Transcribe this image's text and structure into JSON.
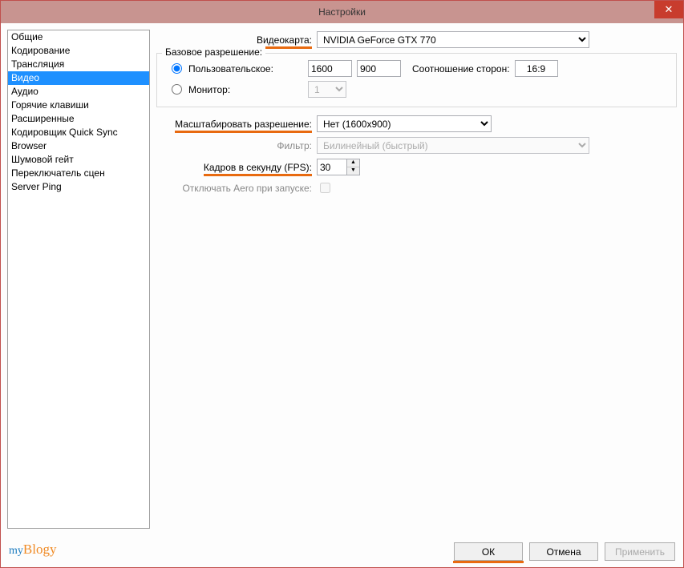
{
  "window": {
    "title": "Настройки",
    "close_glyph": "✕"
  },
  "sidebar": {
    "items": [
      "Общие",
      "Кодирование",
      "Трансляция",
      "Видео",
      "Аудио",
      "Горячие клавиши",
      "Расширенные",
      "Кодировщик Quick Sync",
      "Browser",
      "Шумовой гейт",
      "Переключатель сцен",
      "Server Ping"
    ],
    "selected_index": 3
  },
  "form": {
    "video_card_label": "Видеокарта:",
    "video_card_value": "NVIDIA GeForce GTX 770",
    "base_res_legend": "Базовое разрешение:",
    "radio_custom_label": "Пользовательское:",
    "res_w": "1600",
    "res_h": "900",
    "aspect_label": "Соотношение сторон:",
    "aspect_value": "16:9",
    "radio_monitor_label": "Монитор:",
    "monitor_value": "1",
    "scale_label": "Масштабировать разрешение:",
    "scale_value": "Нет  (1600x900)",
    "filter_label": "Фильтр:",
    "filter_value": "Билинейный (быстрый)",
    "fps_label": "Кадров в секунду (FPS):",
    "fps_value": "30",
    "aero_label": "Отключать Aero при запуске:"
  },
  "footer": {
    "ok": "ОК",
    "cancel": "Отмена",
    "apply": "Применить"
  },
  "watermark": {
    "part1": "my",
    "part2": "Blogy"
  }
}
